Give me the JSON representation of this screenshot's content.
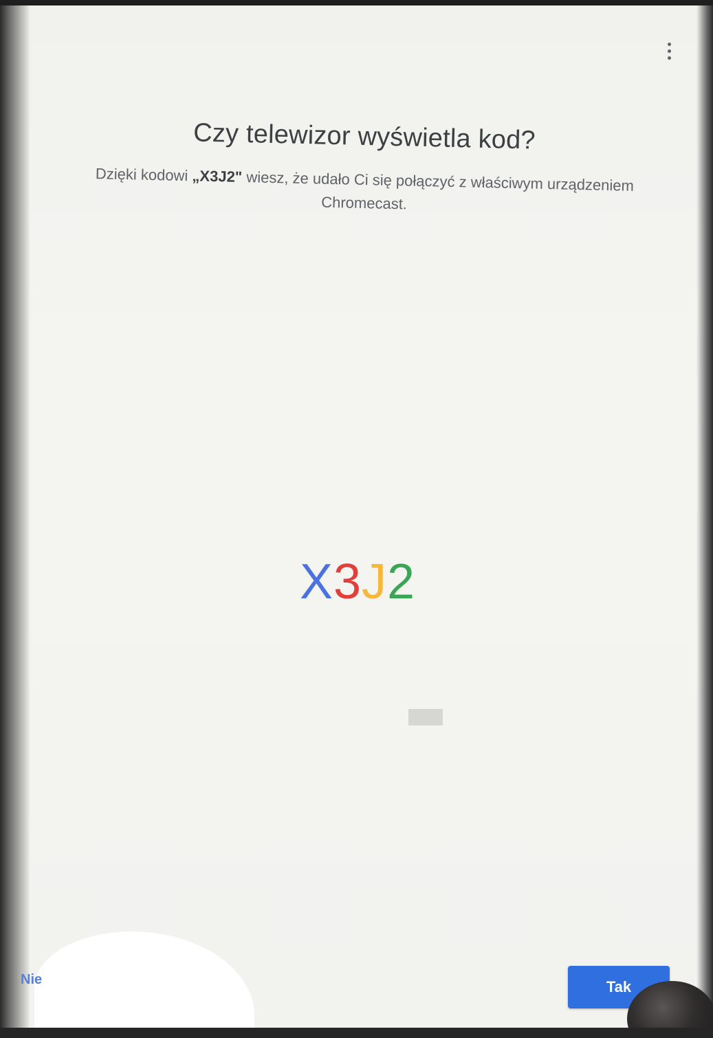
{
  "header": {
    "menu_icon": "more-vert-icon"
  },
  "dialog": {
    "title": "Czy telewizor wyświetla kod?",
    "description_prefix": "Dzięki kodowi ",
    "description_code": "„X3J2\"",
    "description_suffix": " wiesz, że udało Ci się połączyć z właściwym urządzeniem Chromecast.",
    "code_chars": [
      {
        "char": "X",
        "color": "#4a73e0"
      },
      {
        "char": "3",
        "color": "#e0403a"
      },
      {
        "char": "J",
        "color": "#f5b83a"
      },
      {
        "char": "2",
        "color": "#3aa655"
      }
    ]
  },
  "actions": {
    "no_label": "Nie",
    "yes_label": "Tak"
  },
  "colors": {
    "accent": "#2f6fe0",
    "link": "#5a7fd6"
  }
}
